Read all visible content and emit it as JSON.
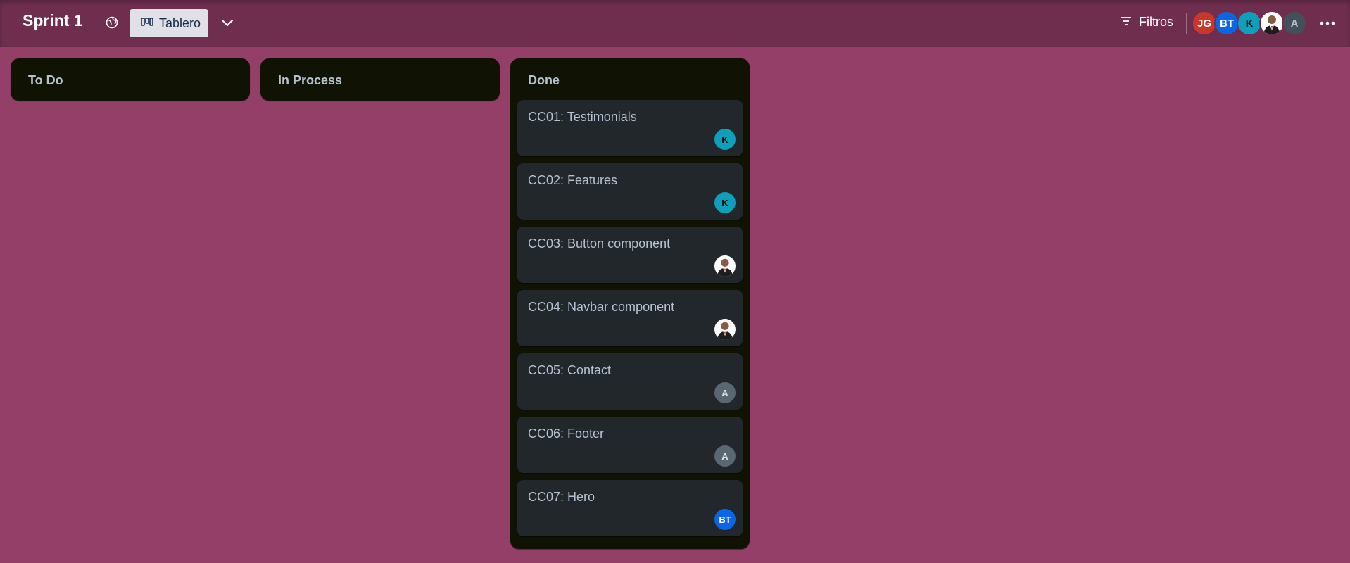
{
  "board": {
    "title": "Sprint 1"
  },
  "header": {
    "view_label": "Tablero",
    "filters_label": "Filtros",
    "members": [
      {
        "initials": "JG",
        "color": "#c9372c"
      },
      {
        "initials": "BT",
        "color": "#0c66e4"
      },
      {
        "initials": "K",
        "color": "#0e9fbd"
      },
      {
        "initials": "",
        "color": "#ffffff",
        "photo": true
      },
      {
        "initials": "A",
        "color": "#454f59"
      }
    ]
  },
  "lists": [
    {
      "title": "To Do",
      "cards": []
    },
    {
      "title": "In Process",
      "cards": []
    },
    {
      "title": "Done",
      "cards": [
        {
          "title": "CC01: Testimonials",
          "member": "K",
          "color": "#0e9fbd"
        },
        {
          "title": "CC02: Features",
          "member": "K",
          "color": "#0e9fbd"
        },
        {
          "title": "CC03: Button component",
          "member": "",
          "color": "#ffffff",
          "photo": true
        },
        {
          "title": "CC04: Navbar component",
          "member": "",
          "color": "#ffffff",
          "photo": true
        },
        {
          "title": "CC05: Contact",
          "member": "A",
          "color": "#596773"
        },
        {
          "title": "CC06: Footer",
          "member": "A",
          "color": "#596773"
        },
        {
          "title": "CC07: Hero",
          "member": "BT",
          "color": "#0c66e4"
        }
      ]
    }
  ],
  "icons": {
    "visibility": "globe-icon",
    "view": "board-icon",
    "expand": "chevron-down-icon",
    "filter": "filter-icon",
    "menu": "more-icon"
  }
}
